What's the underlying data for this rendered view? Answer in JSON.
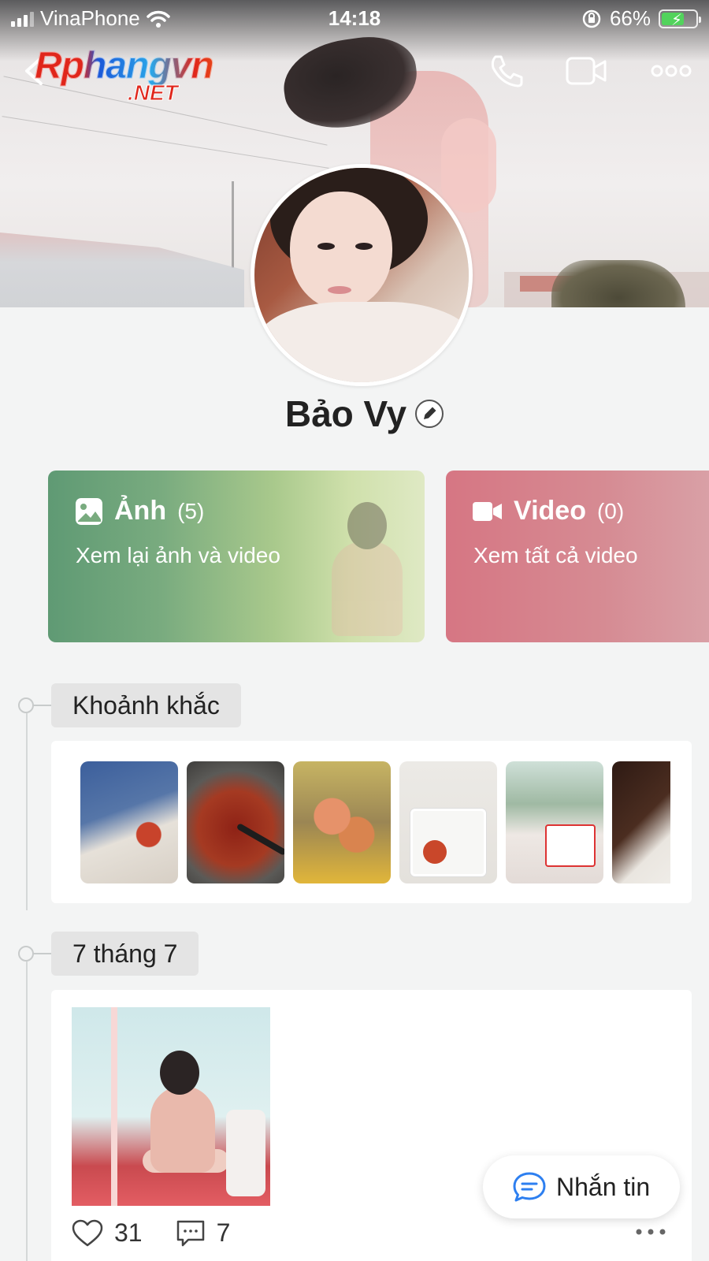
{
  "status_bar": {
    "carrier": "VinaPhone",
    "time": "14:18",
    "battery_percent": "66%",
    "battery_level": 0.66
  },
  "watermark": {
    "line1": "Rphangvn",
    "line2": ".NET"
  },
  "profile": {
    "name": "Bảo Vy"
  },
  "cards": {
    "photos": {
      "title": "Ảnh",
      "count": "(5)",
      "subtitle": "Xem lại ảnh và video"
    },
    "videos": {
      "title": "Video",
      "count": "(0)",
      "subtitle": "Xem tất cả video"
    }
  },
  "timeline": {
    "moments_label": "Khoảnh khắc",
    "date_label": "7 tháng 7"
  },
  "post": {
    "likes": "31",
    "comments": "7"
  },
  "message_button": {
    "label": "Nhắn tin"
  },
  "colors": {
    "photos_card": "#79ab7f",
    "videos_card": "#d67683",
    "message_icon": "#2d7ff0",
    "battery_fill": "#52d35c"
  },
  "icons": [
    "back-icon",
    "phone-icon",
    "video-call-icon",
    "more-icon",
    "edit-icon",
    "image-icon",
    "video-camera-icon",
    "heart-icon",
    "comment-icon",
    "chat-bubble-icon",
    "wifi-icon",
    "rotation-lock-icon"
  ]
}
